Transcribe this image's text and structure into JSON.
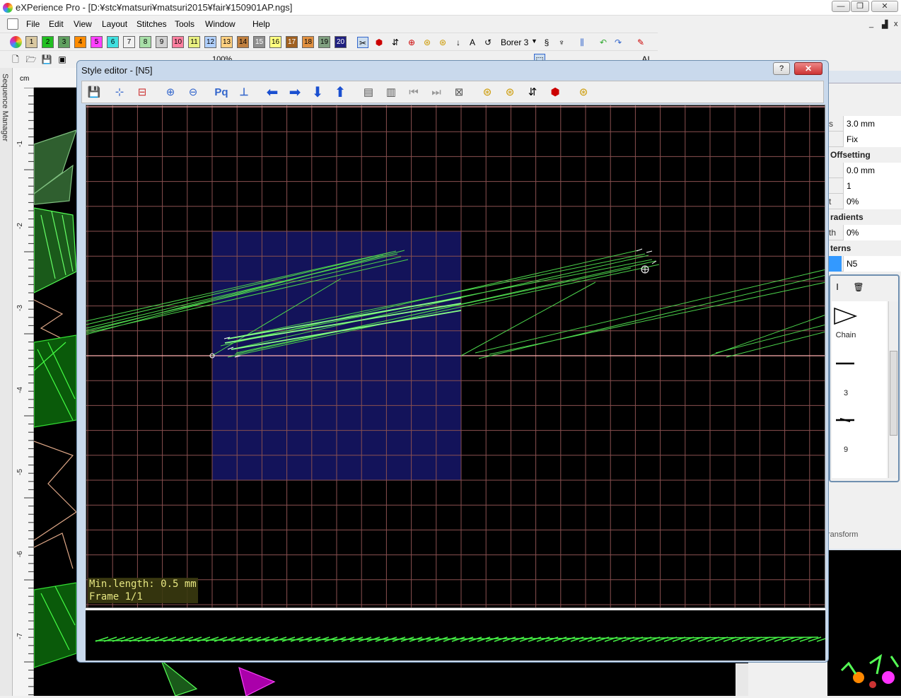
{
  "app": {
    "title": "eXPerience Pro - [D:¥stc¥matsuri¥matsuri2015¥fair¥150901AP.ngs]",
    "window_controls": {
      "minimize": "—",
      "restore": "❐",
      "close": "✕"
    },
    "mdi_controls": {
      "minimize": "_",
      "restore": "▟",
      "close": "x"
    }
  },
  "menu": [
    "File",
    "Edit",
    "View",
    "Layout",
    "Stitches",
    "Tools",
    "Window",
    "Help"
  ],
  "color_swatches": [
    {
      "label": "1",
      "color": "#d9c8a0"
    },
    {
      "label": "2",
      "color": "#22c022"
    },
    {
      "label": "3",
      "color": "#60a060"
    },
    {
      "label": "4",
      "color": "#ff8c00"
    },
    {
      "label": "5",
      "color": "#ff40ff"
    },
    {
      "label": "6",
      "color": "#40e0e0"
    },
    {
      "label": "7",
      "color": "#f0f0f0"
    },
    {
      "label": "8",
      "color": "#a8e0a8"
    },
    {
      "label": "9",
      "color": "#d0d0d0"
    },
    {
      "label": "10",
      "color": "#ff80a0"
    },
    {
      "label": "11",
      "color": "#e8f080"
    },
    {
      "label": "12",
      "color": "#b0d0ff"
    },
    {
      "label": "13",
      "color": "#ffd080"
    },
    {
      "label": "14",
      "color": "#c08040"
    },
    {
      "label": "15",
      "color": "#909090"
    },
    {
      "label": "16",
      "color": "#ffff80"
    },
    {
      "label": "17",
      "color": "#a06020"
    },
    {
      "label": "18",
      "color": "#e09040"
    },
    {
      "label": "19",
      "color": "#80a080"
    },
    {
      "label": "20",
      "color": "#202080"
    }
  ],
  "toolbar1": {
    "borer_label": "Borer 3"
  },
  "toolbar2": {
    "zoom": "100%"
  },
  "left_panel": {
    "label": "Sequence Manager",
    "ruler_unit": "cm",
    "vruler_ticks": [
      "-1",
      "-2",
      "-3",
      "-4",
      "-5",
      "-6",
      "-7"
    ]
  },
  "style_editor": {
    "title": "Style editor -  [N5]",
    "help": "?",
    "close": "✕",
    "status_min_length": "Min.length: 0.5 mm",
    "status_frame": "Frame 1/1"
  },
  "properties": {
    "rows": [
      {
        "key": "s",
        "value": "3.0 mm"
      },
      {
        "key": "",
        "value": "Fix"
      }
    ],
    "section_offsetting": "Offsetting",
    "offset_rows": [
      {
        "key": "",
        "value": "0.0 mm"
      },
      {
        "key": "",
        "value": "1"
      },
      {
        "key": "t",
        "value": "0%"
      }
    ],
    "section_gradients": "radients",
    "gradient_rows": [
      {
        "key": "th",
        "value": "0%"
      }
    ],
    "section_patterns": "terns",
    "pattern_value": "N5",
    "transform_tab": "ransform"
  },
  "stitch_library": {
    "items": [
      {
        "icon": "chain-triangle-icon",
        "label": "Chain"
      },
      {
        "icon": "line-icon",
        "label": "3"
      },
      {
        "icon": "dash-line-icon",
        "label": "9"
      }
    ]
  }
}
